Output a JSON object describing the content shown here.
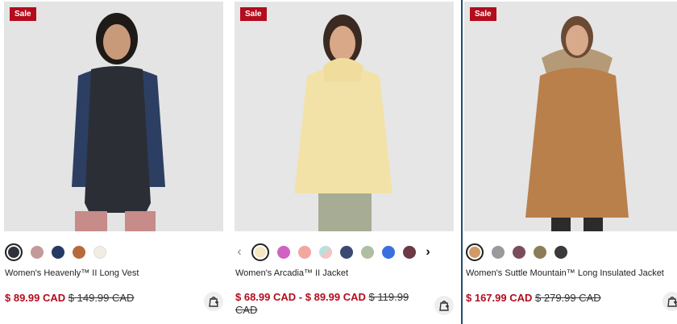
{
  "products": [
    {
      "badge": "Sale",
      "name": "Women's Heavenly™ II Long Vest",
      "sale_price": "$ 89.99 CAD",
      "original_price": "$ 149.99 CAD",
      "swatches": [
        "#2f3339",
        "#c39a9b",
        "#253a63",
        "#b76a3c",
        "#f1ede2"
      ],
      "selected_swatch": 0,
      "image_alt": "Woman wearing dark long quilted vest over navy top with pink pants",
      "bag_icon": "add-to-bag-icon"
    },
    {
      "badge": "Sale",
      "name": "Women's Arcadia™ II Jacket",
      "sale_price": "$ 68.99 CAD",
      "price_separator": "-",
      "sale_price_high": "$ 89.99 CAD",
      "original_price": "$ 119.99 CAD",
      "swatches": [
        "#f6e7bf",
        "#cf62c2",
        "#f2a79f",
        "#b9e0dc",
        "#3b4a72",
        "#aebfa3",
        "#3b6fe0",
        "#6c3a44"
      ],
      "selected_swatch": 0,
      "prev_arrow": "‹",
      "next_arrow": "›",
      "image_alt": "Woman wearing pale yellow rain jacket with sage pants",
      "bag_icon": "add-to-bag-icon"
    },
    {
      "badge": "Sale",
      "name": "Women's Suttle Mountain™ Long Insulated Jacket",
      "sale_price": "$ 167.99 CAD",
      "original_price": "$ 279.99 CAD",
      "swatches": [
        "#d29a66",
        "#9a9a9c",
        "#7a4d5c",
        "#8b7d58",
        "#3a3a3a"
      ],
      "selected_swatch": 0,
      "image_alt": "Woman wearing long tan insulated parka with fur hood",
      "bag_icon": "add-to-bag-icon"
    }
  ]
}
